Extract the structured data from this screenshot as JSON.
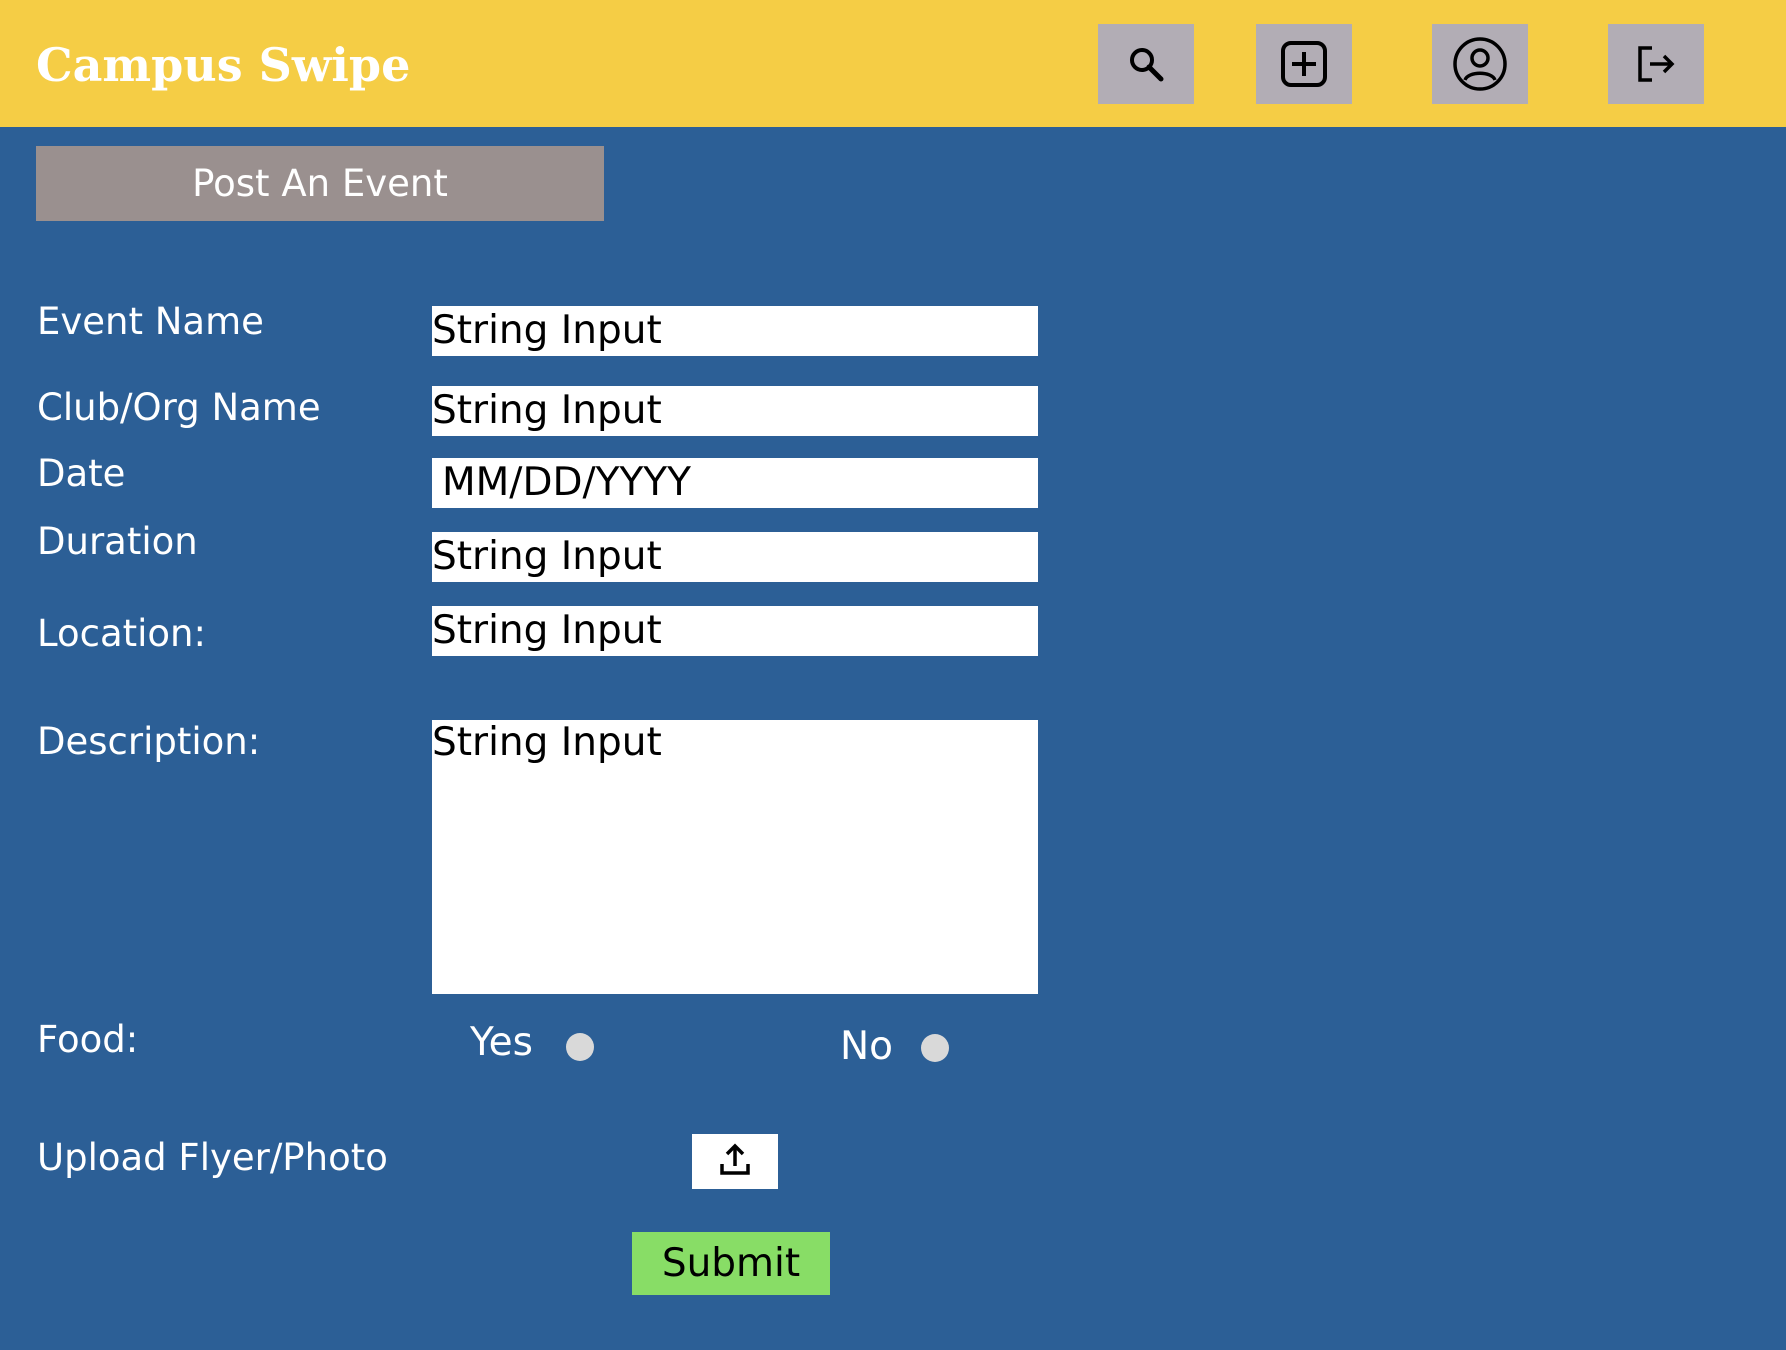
{
  "header": {
    "app_title": "Campus Swipe",
    "background": "#f5cd45",
    "buttons": [
      {
        "icon": "search-icon"
      },
      {
        "icon": "add-square-icon"
      },
      {
        "icon": "user-profile-icon"
      },
      {
        "icon": "logout-icon"
      }
    ]
  },
  "page": {
    "title": "Post An Event",
    "background": "#2c5f96"
  },
  "form": {
    "event_name": {
      "label": "Event Name",
      "value": "String Input"
    },
    "club_name": {
      "label": "Club/Org Name",
      "value": "String Input"
    },
    "date": {
      "label": "Date",
      "value": "MM/DD/YYYY"
    },
    "duration": {
      "label": "Duration",
      "value": "String Input"
    },
    "location": {
      "label": "Location:",
      "value": "String Input"
    },
    "description": {
      "label": "Description:",
      "value": "String Input"
    },
    "food": {
      "label": "Food:",
      "yes_label": "Yes",
      "no_label": "No"
    },
    "upload": {
      "label": "Upload Flyer/Photo",
      "icon": "upload-icon"
    },
    "submit_label": "Submit",
    "submit_color": "#88dd66"
  }
}
